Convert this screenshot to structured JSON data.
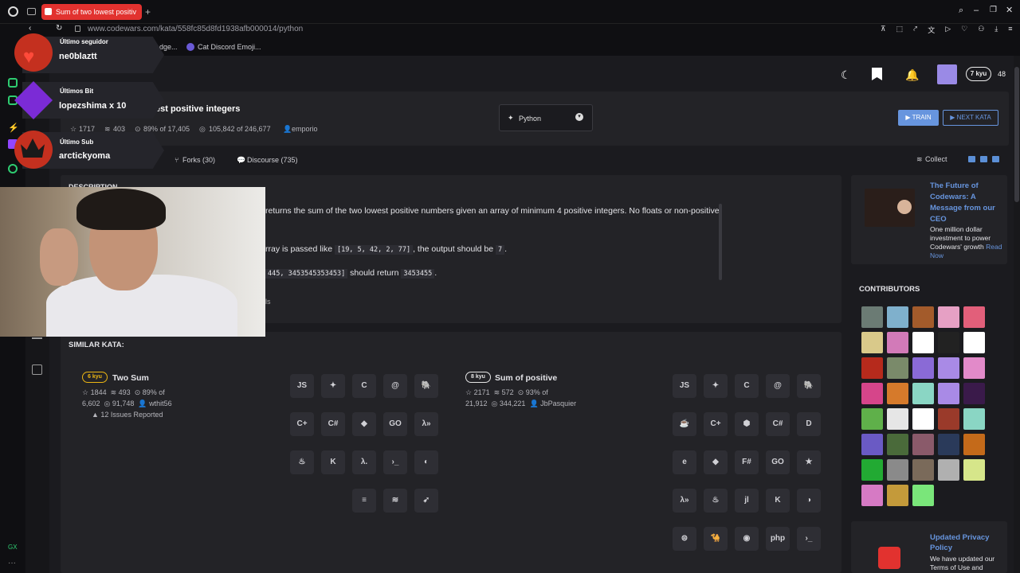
{
  "browser": {
    "tab_title": "Sum of two lowest positiv",
    "url": "www.codewars.com/kata/558fc85d8fd1938afb000014/python",
    "bookmarks": [
      "dge...",
      "Cat Discord Emoji..."
    ]
  },
  "header": {
    "rank_badge": "7 kyu",
    "honor": "48"
  },
  "kata": {
    "title": "est positive integers",
    "stats": [
      "1717",
      "403",
      "89% of 17,405",
      "105,842 of 246,677",
      "emporio"
    ],
    "language": "Python",
    "train_label": "▶ TRAIN",
    "next_label": "▶ NEXT KATA"
  },
  "tabs": {
    "forks": "Forks (30)",
    "discourse": "Discourse (735)",
    "collect": "Collect"
  },
  "description": {
    "heading": "DESCRIPTION",
    "line1": "returns the sum of the two lowest positive numbers given an array of minimum 4 positive integers. No floats or non-positive",
    "line2_pre": "rray is passed like",
    "line2_code": "[19, 5, 42, 2, 77]",
    "line2_mid": ", the output should be",
    "line2_code2": "7",
    "line3_code": "445, 3453545353453]",
    "line3_mid": "should return",
    "line3_code2": "3453455",
    "line4": "ls"
  },
  "similar": {
    "title": "SIMILAR KATA:",
    "items": [
      {
        "kyu": "6 kyu",
        "name": "Two Sum",
        "stats1": "1844",
        "stats2": "493",
        "stats3": "89% of",
        "stats4": "6,602",
        "stats5": "91,748",
        "author": "wthit56",
        "issues": "12 Issues Reported",
        "kyu_color": "#ecb613"
      },
      {
        "kyu": "8 kyu",
        "name": "Sum of positive",
        "stats1": "2171",
        "stats2": "572",
        "stats3": "93% of",
        "stats4": "21,912",
        "stats5": "344,221",
        "author": "JbPasquier",
        "kyu_color": "#e6e6e6"
      }
    ],
    "langs_left": [
      "js-icon",
      "python-icon",
      "c-icon",
      "crystal-icon",
      "elixir-icon",
      "cpp-icon",
      "csharp-icon",
      "elm-icon",
      "go-icon",
      "haskell-icon",
      "java-icon",
      "kotlin-icon",
      "lambda-icon",
      "powershell-icon",
      "raku-icon",
      "r-icon",
      "scala-icon",
      "swift-icon"
    ],
    "langs_right": [
      "js-icon",
      "python-icon",
      "c-icon",
      "crystal-icon",
      "elixir-icon",
      "coffee-icon",
      "cpp-icon",
      "crystal2-icon",
      "csharp-icon",
      "dart-icon",
      "erlang-icon",
      "elm-icon",
      "fsharp-icon",
      "go-icon",
      "groovy-icon",
      "haskell-icon",
      "java-icon",
      "julia-icon",
      "kotlin-icon",
      "lua-icon",
      "nasm-icon",
      "ocaml-icon",
      "perl-icon",
      "php-icon",
      "powershell-icon"
    ]
  },
  "aside": {
    "ad_title": "The Future of Codewars: A Message from our CEO",
    "ad_text": "One million dollar investment to power Codewars' growth",
    "ad_link": "Read Now",
    "contributors_title": "CONTRIBUTORS",
    "avatar_colors": [
      "#6b7b74",
      "#7fb0cc",
      "#a35b2b",
      "#e6a0c4",
      "#e25f7a",
      "#d9c98a",
      "#d27ab8",
      "#ffffff",
      "#222222",
      "#ffffff",
      "#b62a1c",
      "#7a8a6a",
      "#8a6ad6",
      "#a98ae6",
      "#e28ac9",
      "#d6458a",
      "#d67a2b",
      "#8ad6c4",
      "#a98ae6",
      "#3a1a4a",
      "#5fb04a",
      "#e6e6e6",
      "#ffffff",
      "#9a3a2a",
      "#8ad6c4",
      "#6a5ac4",
      "#4a6a3a",
      "#8a5a6a",
      "#2a3a5a",
      "#c46a1a",
      "#22aa33",
      "#8a8a8a",
      "#7a6a5a",
      "#b0b0b0",
      "#d6e68a",
      "#d67ac4",
      "#c49a3a",
      "#7ae67a"
    ],
    "privacy_title": "Updated Privacy Policy",
    "privacy_text": "We have updated our Terms of Use and"
  },
  "overlays": {
    "follower_label": "Último seguidor",
    "follower_name": "ne0blaztt",
    "bits_label": "Últimos Bit",
    "bits_name": "lopezshima x 10",
    "sub_label": "Último Sub",
    "sub_name": "arctickyoma"
  },
  "colors": {
    "accent": "#6795de",
    "brand": "#e2322f",
    "kyu6": "#ecb613"
  }
}
